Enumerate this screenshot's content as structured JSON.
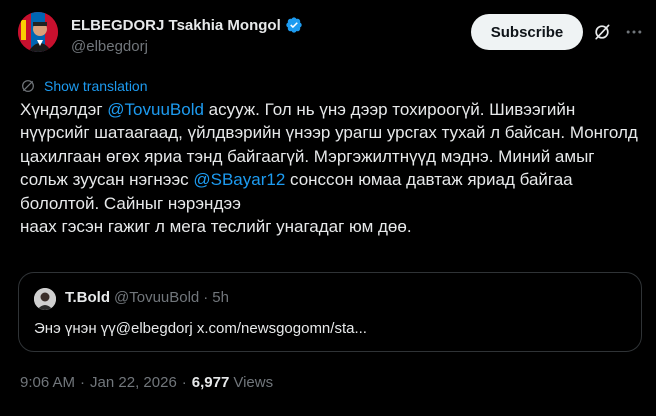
{
  "author": {
    "display_name": "ELBEGDORJ Tsakhia Mongol",
    "handle": "@elbegdorj",
    "verified": true
  },
  "header": {
    "subscribe_label": "Subscribe",
    "grok_icon": "grok-icon",
    "more_icon": "more-horizontal-icon"
  },
  "translate": {
    "label": "Show translation",
    "icon": "globe-icon"
  },
  "tweet": {
    "text_1": "Хүндэлдэг ",
    "mention_1": "@TovuuBold",
    "text_2": " асууж. Гол нь үнэ дээр тохироогүй. Шивээгийн нүүрсийг шатаагаад, үйлдвэрийн үнээр урагш урсгах тухай л байсан. Монголд цахилгаан өгөх яриа тэнд байгаагүй. Мэргэжилтнүүд мэднэ. Миний амыг сольж зуусан нэгнээс ",
    "mention_2": "@SBayar12",
    "text_3": " сонссон юмаа давтаж яриад байгаа бололтой. Сайныг нэрэндээ",
    "text_4": "наах гэсэн гажиг л мега теслийг унагадаг юм дөө."
  },
  "quote": {
    "name": "T.Bold",
    "handle": "@TovuuBold",
    "separator": "·",
    "time": "5h",
    "text": "Энэ үнэн үү@elbegdorj x.com/newsgogomn/sta..."
  },
  "meta": {
    "time": "9:06 AM",
    "separator": "·",
    "date": "Jan 22, 2026",
    "views_count": "6,977",
    "views_label": "Views"
  },
  "colors": {
    "background": "#000000",
    "text": "#e7e9ea",
    "muted": "#71767b",
    "accent": "#1d9bf0",
    "border": "#2f3336"
  }
}
